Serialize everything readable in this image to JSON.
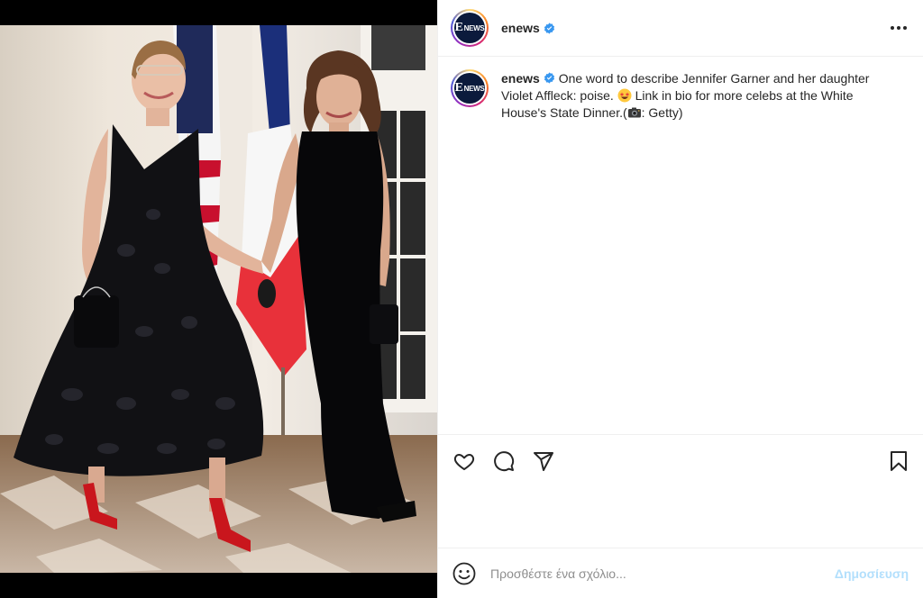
{
  "post": {
    "account": {
      "username": "enews",
      "avatar_text": "NEWS",
      "avatar_letter": "E",
      "verified_icon": "verified-badge-icon"
    },
    "caption": {
      "username": "enews",
      "text_before_emoji": "One word to describe Jennifer Garner and her daughter Violet Affleck: poise.",
      "emoji_1": "star-struck-emoji",
      "text_after_emoji": "Link in bio for more celebs at the White House's State Dinner.(",
      "emoji_2": "camera-emoji",
      "text_end": ": Getty)"
    },
    "icons": {
      "more": "more-options-icon",
      "like": "heart-icon",
      "comment": "comment-icon",
      "share": "paper-plane-icon",
      "save": "bookmark-icon",
      "emoji": "smiley-icon"
    },
    "comment_box": {
      "placeholder": "Προσθέστε ένα σχόλιο...",
      "post_label": "Δημοσίευση"
    },
    "colors": {
      "verified": "#3897f0",
      "post_disabled": "#b2dffc",
      "text": "#262626",
      "muted": "#8e8e8e"
    }
  }
}
